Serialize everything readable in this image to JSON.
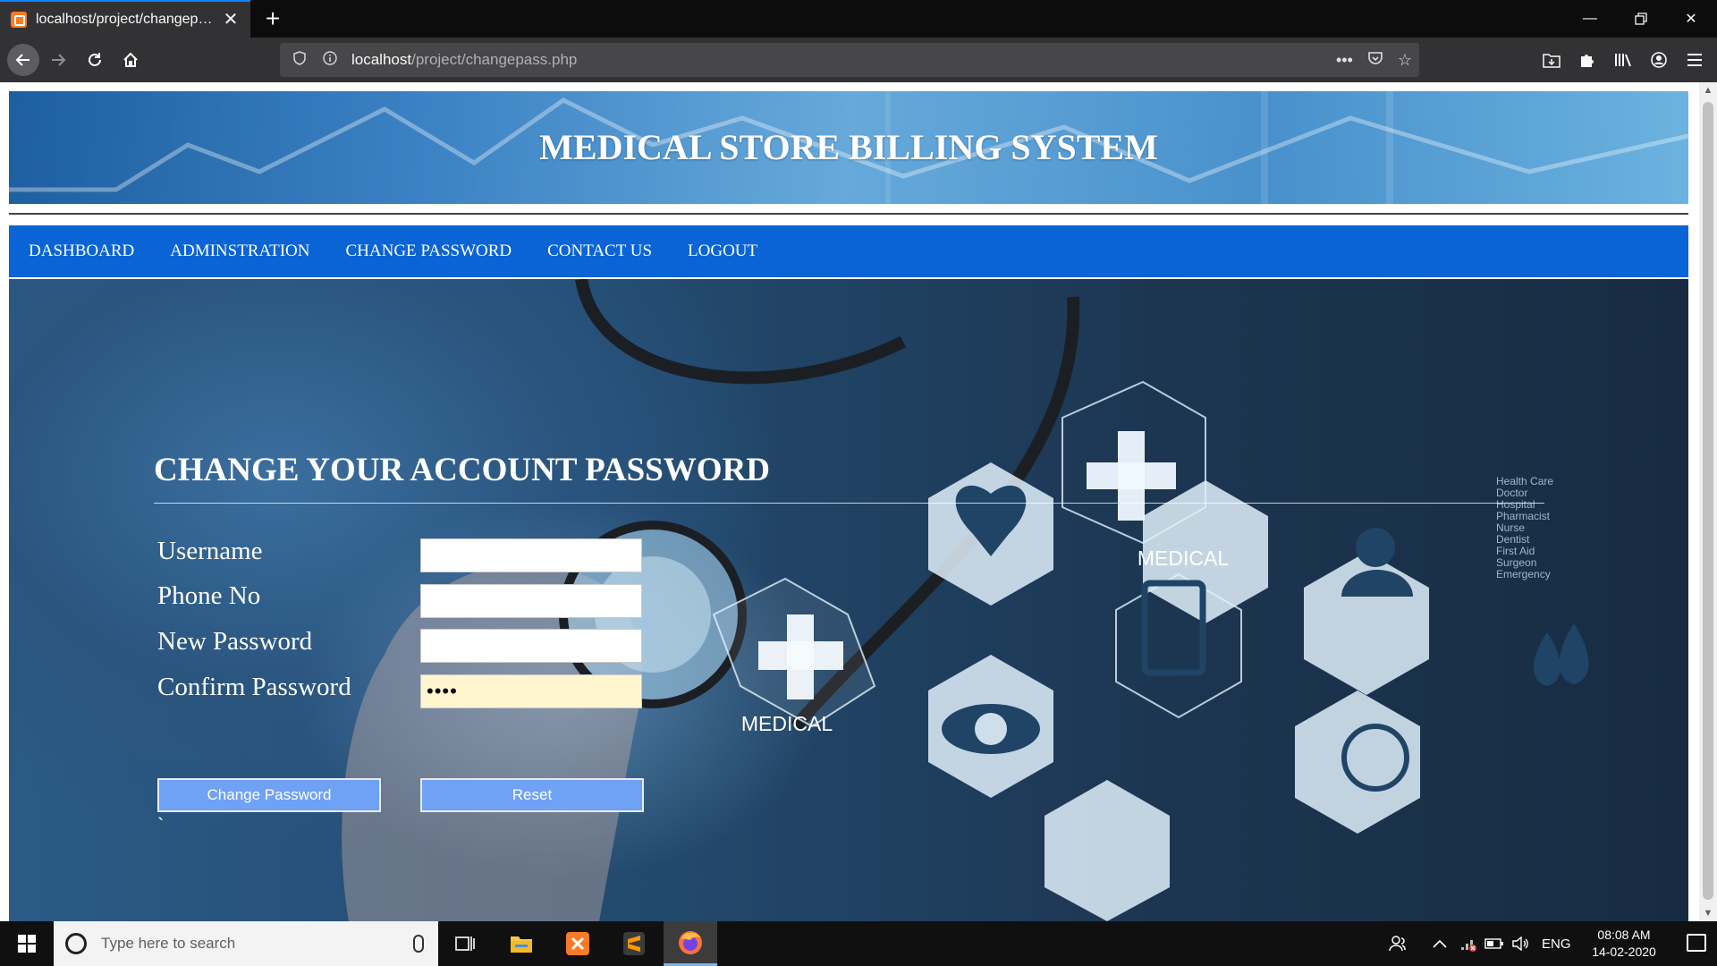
{
  "browser": {
    "tab_title": "localhost/project/changepass.p",
    "url_host": "localhost",
    "url_path": "/project/changepass.php",
    "more_glyph": "•••"
  },
  "site": {
    "title": "MEDICAL STORE BILLING SYSTEM",
    "menu": [
      "DASHBOARD",
      "ADMINSTRATION",
      "CHANGE PASSWORD",
      "CONTACT US",
      "LOGOUT"
    ]
  },
  "hero_image": {
    "hex_labels": [
      "MEDICAL",
      "MEDICAL"
    ],
    "side_list": [
      "Health Care",
      "Doctor",
      "Hospital",
      "Pharmacist",
      "Nurse",
      "Dentist",
      "First Aid",
      "Surgeon",
      "Emergency"
    ]
  },
  "form": {
    "heading": "CHANGE YOUR ACCOUNT PASSWORD",
    "labels": {
      "username": "Username",
      "phone": "Phone No",
      "new_password": "New Password",
      "confirm_password": "Confirm Password"
    },
    "values": {
      "username": "",
      "phone": "",
      "new_password": "",
      "confirm_password": "••••"
    },
    "buttons": {
      "submit": "Change Password",
      "reset": "Reset"
    },
    "stray_text": "`"
  },
  "taskbar": {
    "search_placeholder": "Type here to search",
    "language": "ENG",
    "time": "08:08 AM",
    "date": "14-02-2020"
  },
  "colors": {
    "menu_bg": "#0a64d6",
    "button_bg": "#6fa1f5",
    "autofill_bg": "#fff6cf",
    "tab_accent": "#0a84ff"
  }
}
